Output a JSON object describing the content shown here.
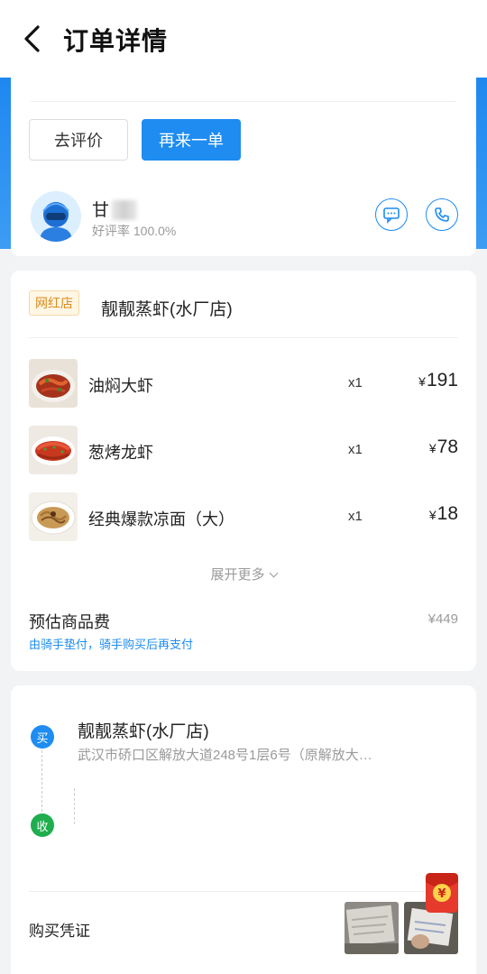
{
  "header": {
    "title": "订单详情"
  },
  "actions": {
    "review_label": "去评价",
    "reorder_label": "再来一单"
  },
  "rider": {
    "name": "甘",
    "rating": "好评率 100.0%"
  },
  "store": {
    "tag": "网红店",
    "name": "靓靓蒸虾(水厂店)"
  },
  "items": [
    {
      "name": "油焖大虾",
      "qty": "x1",
      "yen": "¥",
      "price": "191"
    },
    {
      "name": "葱烤龙虾",
      "qty": "x1",
      "yen": "¥",
      "price": "78"
    },
    {
      "name": "经典爆款凉面（大）",
      "qty": "x1",
      "yen": "¥",
      "price": "18"
    }
  ],
  "expand_label": "展开更多",
  "fee": {
    "label": "预估商品费",
    "note": "由骑手垫付，骑手购买后再支付",
    "value": "¥449"
  },
  "address": {
    "buy_badge": "买",
    "receive_badge": "收",
    "store_name": "靓靓蒸虾(水厂店)",
    "store_address": "武汉市硚口区解放大道248号1层6号（原解放大…"
  },
  "voucher": {
    "label": "购买凭证"
  },
  "redpacket_symbol": "¥",
  "colors": {
    "primary": "#1e8cf0",
    "green": "#1fae4e",
    "tag_orange": "#d98b1d"
  }
}
